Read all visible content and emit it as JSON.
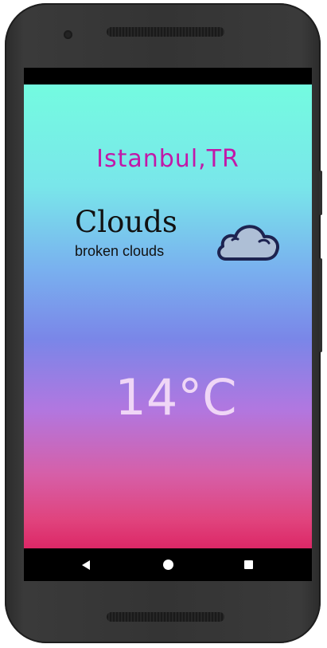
{
  "weather": {
    "city": "Istanbul,TR",
    "condition": "Clouds",
    "description": "broken clouds",
    "temperature": "14°C",
    "icon": "cloud-icon"
  },
  "colors": {
    "city_text": "#c218a8",
    "temperature_text": "#efd6f6",
    "gradient_top": "#74fbe0",
    "gradient_middle": "#7a86e8",
    "gradient_bottom": "#dc2766"
  },
  "navigation": {
    "buttons": [
      "back-icon",
      "home-icon",
      "recents-icon"
    ]
  }
}
